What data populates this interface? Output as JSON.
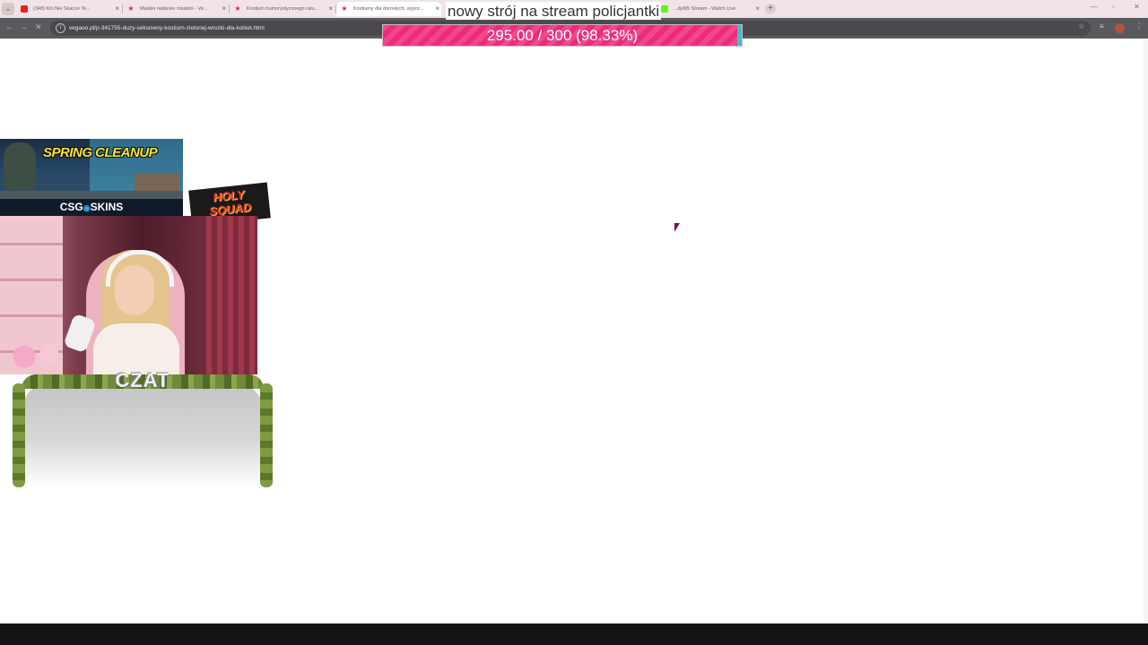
{
  "browser": {
    "tabs": [
      {
        "label": "(348) Kto Nie Skacze Te...",
        "icon": "youtube-icon",
        "color": "#e62117"
      },
      {
        "label": "Męskie nabiesie maskini - Ve...",
        "icon": "vegaoo-icon",
        "color": "#d6245e"
      },
      {
        "label": "Kostium humorystycznego ratu...",
        "icon": "vegaoo-icon",
        "color": "#d6245e"
      },
      {
        "label": "Kostiumy dla dorosłych, wyprz...",
        "icon": "vegaoo-icon",
        "color": "#d6245e"
      },
      {
        "label": "...dyM5 Stream - Watch Live",
        "icon": "kick-icon",
        "color": "#53fc18"
      }
    ],
    "url": "vegaoo.pl/p-341755-duzy-seksowny-kostium-zielonej-wrozki-dla-kobiet.html"
  },
  "overlay": {
    "goal_title": "nowy strój na stream policjantki",
    "goal_text": "295.00 / 300 (98.33%)",
    "goal_progress": 0.9833,
    "goal_color": "#ee2a7b",
    "goal_rest_color": "#3ac2cc",
    "sponsor_title": "SPRING CLEANUP",
    "sponsor_brand_left": "CSG",
    "sponsor_brand_right": "SKINS",
    "team_line1": "HOLY",
    "team_line2": "SQUAD",
    "chat_title": "CZAT"
  }
}
